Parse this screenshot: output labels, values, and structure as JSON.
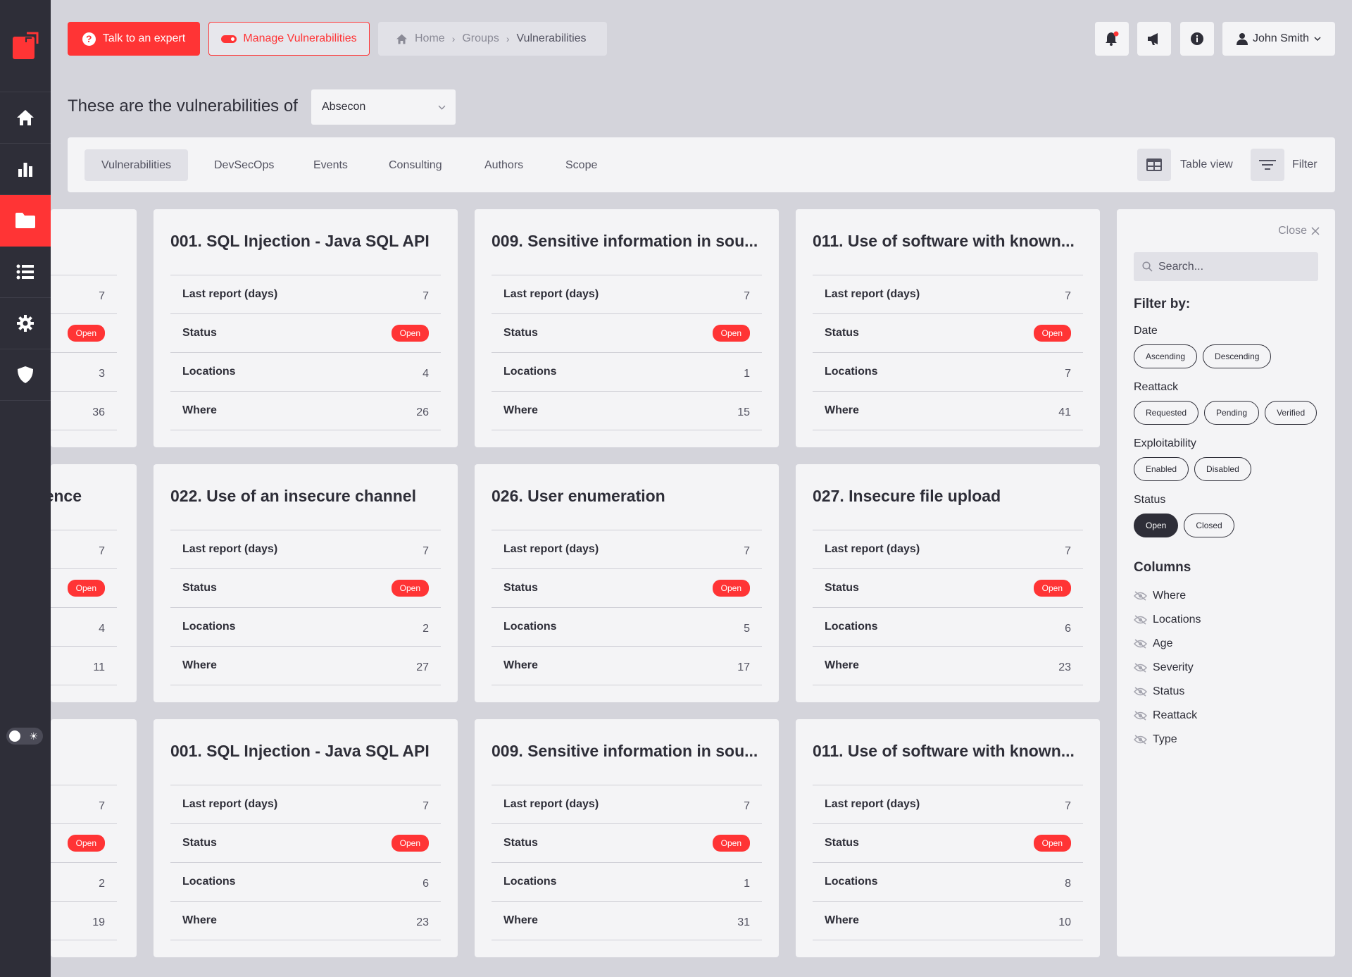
{
  "header": {
    "expert_label": "Talk to an expert",
    "manage_label": "Manage Vulnerabilities",
    "breadcrumb": [
      "Home",
      "Groups",
      "Vulnerabilities"
    ],
    "user_name": "John Smith"
  },
  "title": {
    "text": "These are the vulnerabilities of",
    "selected_group": "Absecon"
  },
  "tabs": [
    "Vulnerabilities",
    "DevSecOps",
    "Events",
    "Consulting",
    "Authors",
    "Scope"
  ],
  "view": {
    "table_label": "Table view",
    "filter_label": "Filter"
  },
  "card_labels": {
    "last_report": "Last report (days)",
    "status": "Status",
    "locations": "Locations",
    "where": "Where"
  },
  "cards": [
    {
      "title": "",
      "last_report": "7",
      "status": "Open",
      "locations": "3",
      "where": "36"
    },
    {
      "title": "001. SQL Injection - Java SQL API",
      "last_report": "7",
      "status": "Open",
      "locations": "4",
      "where": "26"
    },
    {
      "title": "009. Sensitive information in sou...",
      "last_report": "7",
      "status": "Open",
      "locations": "1",
      "where": "15"
    },
    {
      "title": "011. Use of software with known...",
      "last_report": "7",
      "status": "Open",
      "locations": "7",
      "where": "41"
    },
    {
      "title": "ence",
      "last_report": "7",
      "status": "Open",
      "locations": "4",
      "where": "11"
    },
    {
      "title": "022. Use of an insecure channel",
      "last_report": "7",
      "status": "Open",
      "locations": "2",
      "where": "27"
    },
    {
      "title": "026. User enumeration",
      "last_report": "7",
      "status": "Open",
      "locations": "5",
      "where": "17"
    },
    {
      "title": "027. Insecure file upload",
      "last_report": "7",
      "status": "Open",
      "locations": "6",
      "where": "23"
    },
    {
      "title": "",
      "last_report": "7",
      "status": "Open",
      "locations": "2",
      "where": "19"
    },
    {
      "title": "001. SQL Injection - Java SQL API",
      "last_report": "7",
      "status": "Open",
      "locations": "6",
      "where": "23"
    },
    {
      "title": "009. Sensitive information in sou...",
      "last_report": "7",
      "status": "Open",
      "locations": "1",
      "where": "31"
    },
    {
      "title": "011. Use of software with known...",
      "last_report": "7",
      "status": "Open",
      "locations": "8",
      "where": "10"
    }
  ],
  "filter_panel": {
    "close_label": "Close",
    "search_placeholder": "Search...",
    "filter_by": "Filter by:",
    "date_label": "Date",
    "date_options": [
      "Ascending",
      "Descending"
    ],
    "reattack_label": "Reattack",
    "reattack_options": [
      "Requested",
      "Pending",
      "Verified"
    ],
    "exploitability_label": "Exploitability",
    "exploitability_options": [
      "Enabled",
      "Disabled"
    ],
    "status_label": "Status",
    "status_options": [
      "Open",
      "Closed"
    ],
    "status_selected": "Open",
    "columns_heading": "Columns",
    "columns": [
      "Where",
      "Locations",
      "Age",
      "Severity",
      "Status",
      "Reattack",
      "Type"
    ]
  },
  "colors": {
    "accent": "#ff3435",
    "sidebar": "#2e2e38",
    "background": "#d4d4db",
    "surface": "#f4f4f6"
  },
  "icons": {
    "sidebar": [
      "home-icon",
      "chart-icon",
      "folder-icon",
      "list-icon",
      "gear-icon",
      "shield-icon"
    ],
    "top": [
      "bell-icon",
      "megaphone-icon",
      "info-icon",
      "user-icon"
    ]
  }
}
